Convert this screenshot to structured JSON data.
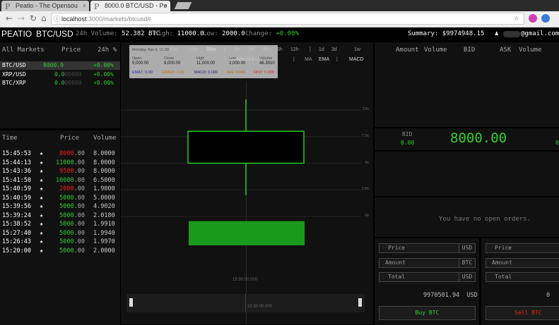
{
  "browser": {
    "tabs": [
      {
        "title": "Peatio - The Opensou",
        "active": false
      },
      {
        "title": "8000.0 BTC/USD - Pe",
        "active": true
      }
    ],
    "url_host": "localhost",
    "url_path": ":3000/markets/btcusd#"
  },
  "header": {
    "logo": "PEATIO",
    "market": "BTC/USD",
    "volume_label": "24h Volume:",
    "volume_value": "52.382 BTC",
    "high_label": "High:",
    "high_value": "11000.0",
    "low_label": "Low:",
    "low_value": "2000.0",
    "change_label": "Change:",
    "change_value": "+0.00%",
    "summary_label": "Summary:",
    "summary_value": "$9974948.15",
    "user_email": "@gmail.com"
  },
  "markets": {
    "title": "All Markets",
    "col_price": "Price",
    "col_change": "24h %",
    "rows": [
      {
        "name": "BTC/USD",
        "price": "8000.0",
        "price_dim": "",
        "change": "+0.00%",
        "selected": true
      },
      {
        "name": "XRP/USD",
        "price": "0.0",
        "price_dim": "00000",
        "change": "+0.00%",
        "selected": false
      },
      {
        "name": "BTC/XRP",
        "price": "0.0",
        "price_dim": "00000",
        "change": "+0.00%",
        "selected": false
      }
    ]
  },
  "trades": {
    "col_time": "Time",
    "col_price": "Price",
    "col_volume": "Volume",
    "rows": [
      {
        "time": "15:45:53",
        "price": "8000",
        "dec": ".00",
        "volume": "8.0000",
        "color": "red"
      },
      {
        "time": "15:44:13",
        "price": "11000",
        "dec": ".00",
        "volume": "8.0000",
        "color": "green"
      },
      {
        "time": "15:43:36",
        "price": "9500",
        "dec": ".00",
        "volume": "8.0000",
        "color": "red"
      },
      {
        "time": "15:41:50",
        "price": "10000",
        "dec": ".00",
        "volume": "6.5000",
        "color": "green"
      },
      {
        "time": "15:40:59",
        "price": "2000",
        "dec": ".00",
        "volume": "1.9000",
        "color": "red"
      },
      {
        "time": "15:40:59",
        "price": "5000",
        "dec": ".00",
        "volume": "5.0000",
        "color": "green"
      },
      {
        "time": "15:39:56",
        "price": "5000",
        "dec": ".00",
        "volume": "4.9020",
        "color": "green"
      },
      {
        "time": "15:39:24",
        "price": "5000",
        "dec": ".00",
        "volume": "2.0180",
        "color": "green"
      },
      {
        "time": "15:38:52",
        "price": "5000",
        "dec": ".00",
        "volume": "1.9910",
        "color": "green"
      },
      {
        "time": "15:27:40",
        "price": "5000",
        "dec": ".00",
        "volume": "1.9940",
        "color": "green"
      },
      {
        "time": "15:26:43",
        "price": "5000",
        "dec": ".00",
        "volume": "1.9970",
        "color": "green"
      },
      {
        "time": "15:20:00",
        "price": "5000",
        "dec": ".00",
        "volume": "2.0000",
        "color": "green"
      }
    ]
  },
  "chart": {
    "ranges": [
      "1m",
      "5m",
      "15m",
      "30m",
      "|",
      "1h",
      "2h",
      "4h",
      "6h",
      "12h",
      "|",
      "1d",
      "3d",
      "1w"
    ],
    "active_range": "30m",
    "types": [
      "Candlestick",
      "Line",
      "|",
      "MA",
      "EMA",
      "|",
      "MACD"
    ],
    "info": {
      "date": "Monday, Apr 3, 15:30",
      "open_label": "Open",
      "open_value": "5,000.00",
      "close_label": "Close",
      "close_value": "8,000.00",
      "high_label": "High",
      "high_value": "11,000.00",
      "low_label": "Low",
      "low_value": "2,000.00",
      "vol_label": "Volume",
      "vol_value": "46.3910",
      "emat_label": "EMA7:",
      "emat_value": "0.00",
      "ema30_label": "EMA30:",
      "ema30_value": "0.00",
      "macd_label": "MACD:",
      "macd_value": "0.000",
      "sig_label": "SIG:",
      "sig_value": "0.000",
      "hist_label": "HIST:",
      "hist_value": "0.000"
    },
    "y_ticks": [
      "10k",
      "7.5k",
      "5k",
      "2.5k",
      "0k"
    ],
    "x_label": "15:30:00.000",
    "nav_label": "15:30:00.000"
  },
  "chart_data": {
    "type": "candlestick",
    "x": [
      "15:30:00.000"
    ],
    "ohlc": [
      {
        "open": 5000,
        "high": 11000,
        "low": 2000,
        "close": 8000
      }
    ],
    "volume": [
      46.391
    ],
    "yticks": [
      10000,
      7500,
      5000,
      2500,
      0
    ],
    "ylim": [
      0,
      12000
    ]
  },
  "orderbook": {
    "col_amount": "Amount",
    "col_volume": "Volume",
    "col_bid": "BID",
    "col_ask": "ASK",
    "col_volume2": "Volume",
    "bid_label": "BID",
    "bid_value": "0.00",
    "last_price": "8000.00",
    "ask_value": "0"
  },
  "orders": {
    "empty_text": "You have no open orders."
  },
  "buy_form": {
    "price_label": "Price",
    "price_unit": "USD",
    "amount_label": "Amount",
    "amount_unit": "BTC",
    "total_label": "Total",
    "total_unit": "USD",
    "balance": "9970501.94",
    "balance_unit": "USD",
    "submit": "Buy BTC"
  },
  "sell_form": {
    "price_label": "Price",
    "amount_label": "Amount",
    "total_label": "Total",
    "balance": "0",
    "submit": "Sell BTC"
  },
  "colors": {
    "green": "#33cc33",
    "red": "#ee2222",
    "candle": "#1a9a1a"
  }
}
